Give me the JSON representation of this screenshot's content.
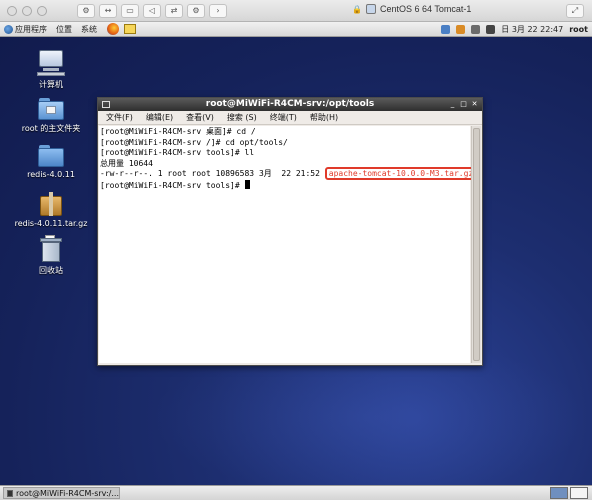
{
  "vm_window": {
    "title": "CentOS 6 64 Tomcat-1",
    "toolbar_icons": [
      "wrench-icon",
      "resize-icon",
      "disk-icon",
      "speaker-icon",
      "usb-icon",
      "settings-icon",
      "chevron-icon"
    ]
  },
  "panel": {
    "menus": [
      "应用程序",
      "位置",
      "系统"
    ],
    "launchers": [
      "firefox-icon",
      "notes-icon"
    ],
    "clock": "日 3月 22 22:47",
    "user": "root"
  },
  "desktop_icons": [
    {
      "label": "计算机",
      "icon": "computer-icon"
    },
    {
      "label": "root 的主文件夹",
      "icon": "home-folder-icon"
    },
    {
      "label": "redis-4.0.11",
      "icon": "folder-icon"
    },
    {
      "label": "redis-4.0.11.tar.gz",
      "icon": "archive-icon"
    },
    {
      "label": "回收站",
      "icon": "trash-icon"
    }
  ],
  "terminal": {
    "title": "root@MiWiFi-R4CM-srv:/opt/tools",
    "menu": [
      "文件(F)",
      "编辑(E)",
      "查看(V)",
      "搜索 (S)",
      "终端(T)",
      "帮助(H)"
    ],
    "lines": [
      "[root@MiWiFi-R4CM-srv 桌面]# cd /",
      "[root@MiWiFi-R4CM-srv /]# cd opt/tools/",
      "[root@MiWiFi-R4CM-srv tools]# ll",
      "总用量 10644"
    ],
    "listing_prefix": "-rw-r--r--. 1 root root 10896583 3月  22 21:52 ",
    "listing_file": "apache-tomcat-10.0.0-M3.tar.gz",
    "prompt": "[root@MiWiFi-R4CM-srv tools]# ",
    "highlight_color": "#e03a2a"
  },
  "taskbar": {
    "active_window": "root@MiWiFi-R4CM-srv:/...",
    "workspaces": 2
  }
}
